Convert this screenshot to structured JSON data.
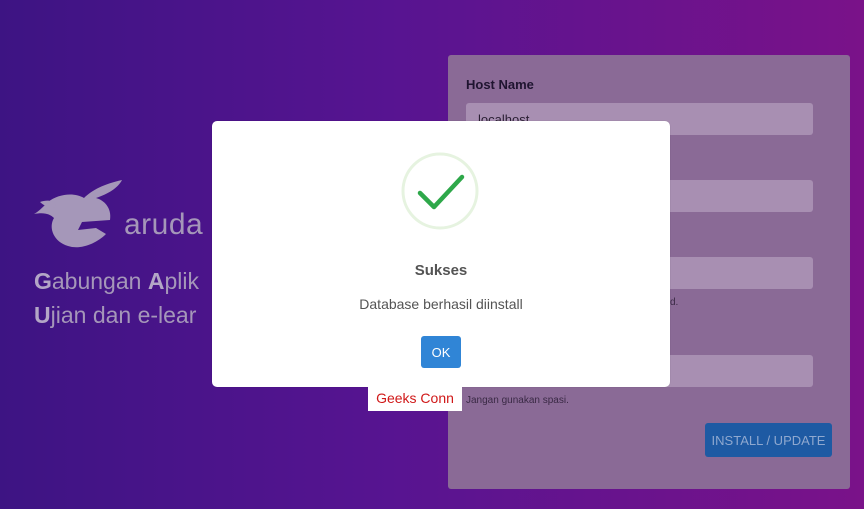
{
  "brand": {
    "logo_name": "aruda",
    "tagline_line1": {
      "initial1": "G",
      "rest1": "abungan ",
      "initial2": "A",
      "rest2": "plik"
    },
    "tagline_line2": {
      "initial": "U",
      "rest": "jian dan e-lear"
    }
  },
  "form": {
    "host_label": "Host Name",
    "host_value": "localhost",
    "help_password_tail": "d.",
    "help_nospace": "Jangan gunakan spasi.",
    "install_button": "INSTALL / UPDATE"
  },
  "modal": {
    "title": "Sukses",
    "text": "Database berhasil diinstall",
    "ok_label": "OK",
    "icon": "check-icon",
    "accent": "#3085d6",
    "check_color": "#2ea84a"
  },
  "watermark": {
    "text": "Geeks Conn",
    "color": "#d01818"
  }
}
